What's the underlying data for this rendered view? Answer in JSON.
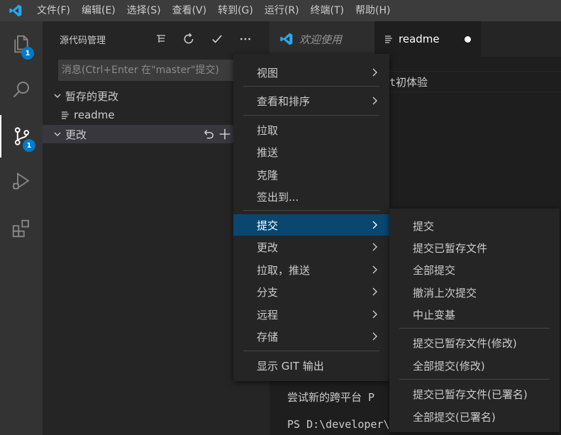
{
  "menubar": {
    "items": [
      "文件(F)",
      "编辑(E)",
      "选择(S)",
      "查看(V)",
      "转到(G)",
      "运行(R)",
      "终端(T)",
      "帮助(H)"
    ]
  },
  "activity": {
    "explorer_badge": "1",
    "scm_badge": "1"
  },
  "sidebar": {
    "title": "源代码管理",
    "message_placeholder": "消息(Ctrl+Enter 在\"master\"提交)",
    "staged_label": "暂存的更改",
    "staged_file": "readme",
    "changes_label": "更改"
  },
  "editor": {
    "tabs": [
      {
        "label": "欢迎使用"
      },
      {
        "label": "readme"
      }
    ],
    "lines": [
      "it初体验",
      "尝试新的跨平台 P",
      "PS D:\\developer\\"
    ]
  },
  "context_menu": {
    "items": [
      {
        "label": "视图",
        "submenu": true
      },
      {
        "label": "查看和排序",
        "submenu": true
      },
      {
        "label": "拉取",
        "submenu": false
      },
      {
        "label": "推送",
        "submenu": false
      },
      {
        "label": "克隆",
        "submenu": false
      },
      {
        "label": "签出到...",
        "submenu": false
      },
      {
        "label": "提交",
        "submenu": true,
        "active": true
      },
      {
        "label": "更改",
        "submenu": true
      },
      {
        "label": "拉取，推送",
        "submenu": true
      },
      {
        "label": "分支",
        "submenu": true
      },
      {
        "label": "远程",
        "submenu": true
      },
      {
        "label": "存储",
        "submenu": true
      },
      {
        "label": "显示 GIT 输出",
        "submenu": false
      }
    ]
  },
  "submenu": {
    "items": [
      "提交",
      "提交已暂存文件",
      "全部提交",
      "撤消上次提交",
      "中止变基",
      "提交已暂存文件(修改)",
      "全部提交(修改)",
      "提交已暂存文件(已署名)",
      "全部提交(已署名)"
    ]
  },
  "colors": {
    "accent": "#007acc",
    "menu_active": "#094771",
    "vscode_blue": "#23a9f2"
  }
}
